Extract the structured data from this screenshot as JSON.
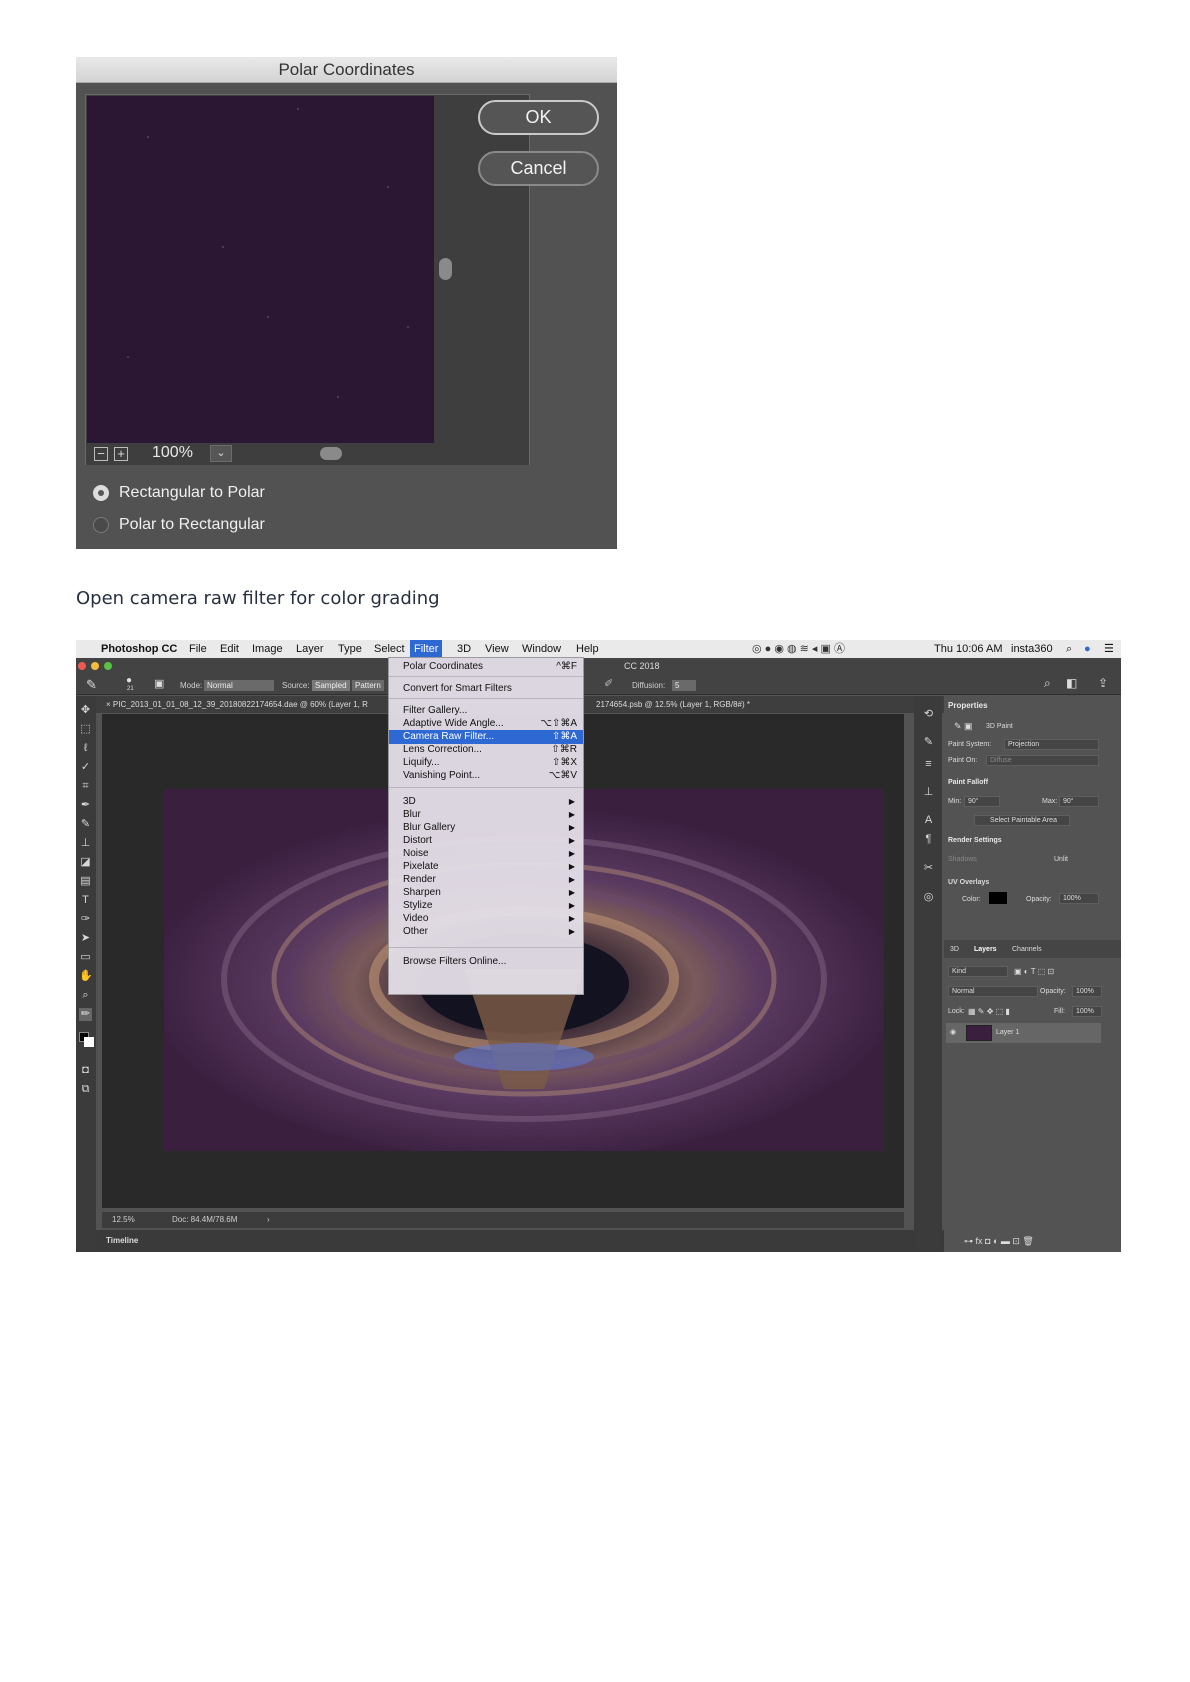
{
  "polar_dialog": {
    "title": "Polar Coordinates",
    "ok_label": "OK",
    "cancel_label": "Cancel",
    "zoom_out_glyph": "−",
    "zoom_in_glyph": "+",
    "zoom_value": "100%",
    "zoom_dropdown_glyph": "⌄",
    "options": [
      {
        "label": "Rectangular to Polar",
        "selected": true
      },
      {
        "label": "Polar to Rectangular",
        "selected": false
      }
    ]
  },
  "caption": "Open camera raw filter for color grading",
  "photoshop": {
    "menubar": {
      "apple_glyph": "",
      "app": "Photoshop CC",
      "menus": [
        "File",
        "Edit",
        "Image",
        "Layer",
        "Type",
        "Select",
        "Filter",
        "3D",
        "View",
        "Window",
        "Help"
      ],
      "active_menu": "Filter",
      "clock": "Thu 10:06 AM",
      "user": "insta360",
      "title_fragment": "CC 2018"
    },
    "options_bar": {
      "brush_size": "21",
      "mode_label": "Mode:",
      "mode_value": "Normal",
      "source_label": "Source:",
      "source_sampled": "Sampled",
      "source_pattern": "Pattern",
      "diffusion_label": "Diffusion:",
      "diffusion_value": "5"
    },
    "doc_tab": "×  PIC_2013_01_01_08_12_39_20180822174654.dae @ 60% (Layer 1, R",
    "doc_tab2": "2174654.psb @ 12.5% (Layer 1, RGB/8#) *",
    "status": {
      "zoom": "12.5%",
      "doc": "Doc: 84.4M/78.6M",
      "arrow": "›"
    },
    "timeline_label": "Timeline",
    "filter_menu": {
      "items": [
        {
          "label": "Polar Coordinates",
          "shortcut": "^⌘F"
        },
        {
          "label": "Convert for Smart Filters",
          "shortcut": ""
        },
        {
          "label": "Filter Gallery...",
          "shortcut": ""
        },
        {
          "label": "Adaptive Wide Angle...",
          "shortcut": "⌥⇧⌘A"
        },
        {
          "label": "Camera Raw Filter...",
          "shortcut": "⇧⌘A",
          "highlighted": true
        },
        {
          "label": "Lens Correction...",
          "shortcut": "⇧⌘R"
        },
        {
          "label": "Liquify...",
          "shortcut": "⇧⌘X"
        },
        {
          "label": "Vanishing Point...",
          "shortcut": "⌥⌘V"
        },
        {
          "label": "3D",
          "submenu": true
        },
        {
          "label": "Blur",
          "submenu": true
        },
        {
          "label": "Blur Gallery",
          "submenu": true
        },
        {
          "label": "Distort",
          "submenu": true
        },
        {
          "label": "Noise",
          "submenu": true
        },
        {
          "label": "Pixelate",
          "submenu": true
        },
        {
          "label": "Render",
          "submenu": true
        },
        {
          "label": "Sharpen",
          "submenu": true
        },
        {
          "label": "Stylize",
          "submenu": true
        },
        {
          "label": "Video",
          "submenu": true
        },
        {
          "label": "Other",
          "submenu": true
        },
        {
          "label": "Browse Filters Online...",
          "shortcut": ""
        }
      ],
      "submenu_arrow": "▶"
    },
    "properties": {
      "title": "Properties",
      "mode": "3D Paint",
      "paint_system_label": "Paint System:",
      "paint_system_value": "Projection",
      "paint_on_label": "Paint On:",
      "paint_on_value": "Diffuse",
      "falloff_title": "Paint Falloff",
      "min_label": "Min:",
      "min_value": "90°",
      "max_label": "Max:",
      "max_value": "90°",
      "select_area_btn": "Select Paintable Area",
      "render_title": "Render Settings",
      "shadows_label": "Shadows",
      "unlit_label": "Unlit",
      "uv_label": "UV Overlays",
      "color_label": "Color:",
      "opacity_label": "Opacity:",
      "opacity_value": "100%"
    },
    "layers": {
      "tabs": [
        "3D",
        "Layers",
        "Channels"
      ],
      "kind": "Kind",
      "blend": "Normal",
      "opacity_label": "Opacity:",
      "opacity_value": "100%",
      "lock_label": "Lock:",
      "fill_label": "Fill:",
      "fill_value": "100%",
      "layer_name": "Layer 1"
    },
    "colors": {
      "menu_highlight": "#2e69d3",
      "doc_background": "#3a1f3f",
      "preview_background": "#2b1633"
    }
  }
}
